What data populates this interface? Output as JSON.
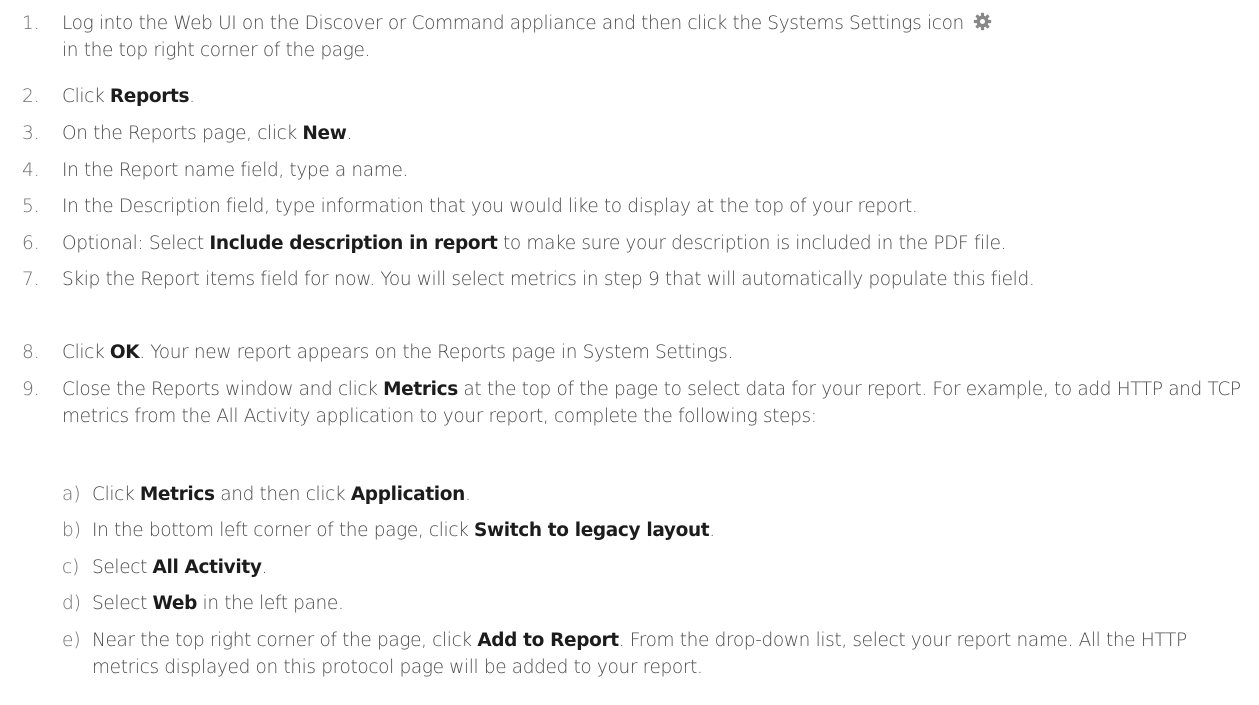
{
  "steps": [
    {
      "num": "1.",
      "pre": "Log into the Web UI on the Discover or Command appliance and then click the Systems Settings icon",
      "post": "in the top right corner of the page.",
      "icon": "gear-icon"
    },
    {
      "num": "2.",
      "pre": "Click ",
      "bold": "Reports",
      "post": "."
    },
    {
      "num": "3.",
      "pre": "On the Reports page, click ",
      "bold": "New",
      "post": "."
    },
    {
      "num": "4.",
      "text": "In the Report name field, type a name."
    },
    {
      "num": "5.",
      "text": "In the Description field, type information that you would like to display at the top of your report."
    },
    {
      "num": "6.",
      "pre": "Optional: Select ",
      "bold": "Include description in report",
      "post": " to make sure your description is included in the PDF file."
    },
    {
      "num": "7.",
      "text": "Skip the Report items field for now. You will select metrics in step 9 that will automatically populate this field."
    },
    {
      "num": "8.",
      "pre": "Click ",
      "bold": "OK",
      "post": ". Your new report appears on the Reports page in System Settings."
    },
    {
      "num": "9.",
      "pre": "Close the Reports window and click ",
      "bold": "Metrics",
      "post": " at the top of the page to select data for your report. For example, to add HTTP and TCP metrics from the All Activity application to your report, complete the following steps:"
    }
  ],
  "substeps": [
    {
      "num": "a)",
      "pre": "Click ",
      "bold": "Metrics",
      "mid": " and then click ",
      "bold2": "Application",
      "post": "."
    },
    {
      "num": "b)",
      "pre": "In the bottom left corner of the page, click ",
      "bold": "Switch to legacy layout",
      "post": "."
    },
    {
      "num": "c)",
      "pre": "Select ",
      "bold": "All Activity",
      "post": "."
    },
    {
      "num": "d)",
      "pre": "Select ",
      "bold": "Web",
      "post": " in the left pane."
    },
    {
      "num": "e)",
      "pre": "Near the top right corner of the page, click ",
      "bold": "Add to Report",
      "post": ". From the drop-down list, select your report name. All the HTTP metrics displayed on this protocol page will be added to your report."
    }
  ],
  "colors": {
    "text": "#4a4a4a",
    "number": "#6e6e6e",
    "bold": "#1c1c1c",
    "icon": "#888888"
  }
}
